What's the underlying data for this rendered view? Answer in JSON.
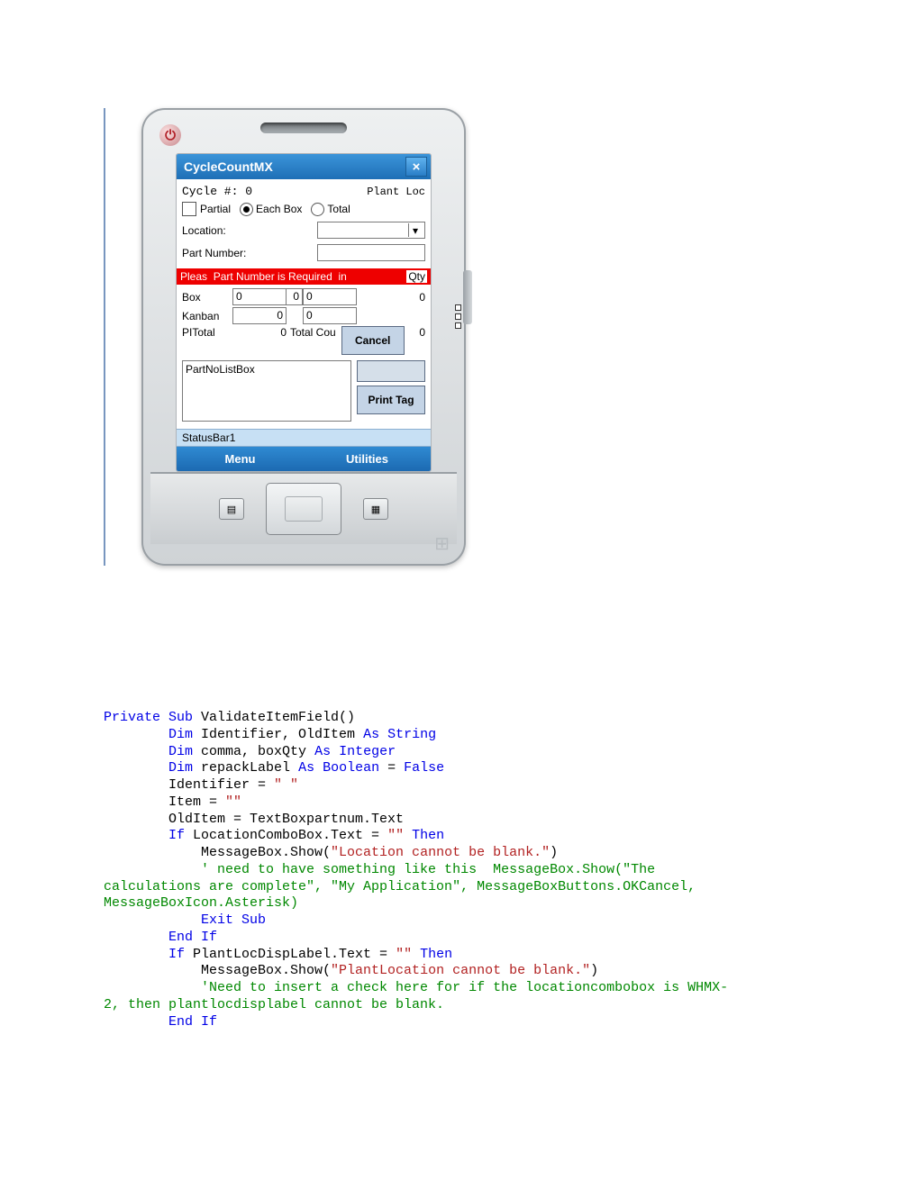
{
  "app": {
    "title": "CycleCountMX",
    "cycle_label": "Cycle #:",
    "cycle_value": "0",
    "plantloc_label": "Plant Loc",
    "partial_label": "Partial",
    "eachbox_label": "Each Box",
    "total_label": "Total",
    "location_label": "Location:",
    "partnumber_label": "Part Number:",
    "error_left": "Pleas",
    "error_mid": "Part Number is Required",
    "error_right_in": "in",
    "qty_label": "Qty",
    "box_label": "Box",
    "box_v1": "0",
    "box_v2": "0",
    "box_v3": "0",
    "box_v4": "0",
    "kanban_label": "Kanban",
    "kanban_v1": "0",
    "kanban_v2": "0",
    "pitotal_label": "PITotal",
    "pitotal_v": "0",
    "totalcou_label": "Total Cou",
    "pitotal_right": "0",
    "cancel_label": "Cancel",
    "listbox_label": "PartNoListBox",
    "printtag_label": "Print Tag",
    "statusbar_text": "StatusBar1",
    "menu_left": "Menu",
    "menu_right": "Utilities"
  },
  "code": {
    "l1a": "Private Sub",
    "l1b": " ValidateItemField()",
    "l2a": "        Dim",
    "l2b": " Identifier, OldItem ",
    "l2c": "As String",
    "l3a": "        Dim",
    "l3b": " comma, boxQty ",
    "l3c": "As Integer",
    "l4a": "        Dim",
    "l4b": " repackLabel ",
    "l4c": "As Boolean",
    "l4d": " = ",
    "l4e": "False",
    "l5": "        Identifier = ",
    "l5s": "\" \"",
    "l6": "        Item = ",
    "l6s": "\"\"",
    "l7": "        OldItem = TextBoxpartnum.Text",
    "l8a": "        If",
    "l8b": " LocationComboBox.Text = ",
    "l8s": "\"\"",
    "l8c": " Then",
    "l9a": "            MessageBox.Show(",
    "l9s": "\"Location cannot be blank.\"",
    "l9b": ")",
    "l10": "            ' need to have something like this  MessageBox.Show(\"The",
    "l11": "calculations are complete\", \"My Application\", MessageBoxButtons.OKCancel,",
    "l12": "MessageBoxIcon.Asterisk)",
    "l13": "            Exit Sub",
    "l14": "        End If",
    "l15a": "        If",
    "l15b": " PlantLocDispLabel.Text = ",
    "l15s": "\"\"",
    "l15c": " Then",
    "l16a": "            MessageBox.Show(",
    "l16s": "\"PlantLocation cannot be blank.\"",
    "l16b": ")",
    "l17": "            'Need to insert a check here for if the locationcombobox is WHMX-",
    "l18": "2, then plantlocdisplabel cannot be blank.",
    "l19": "        End If"
  }
}
